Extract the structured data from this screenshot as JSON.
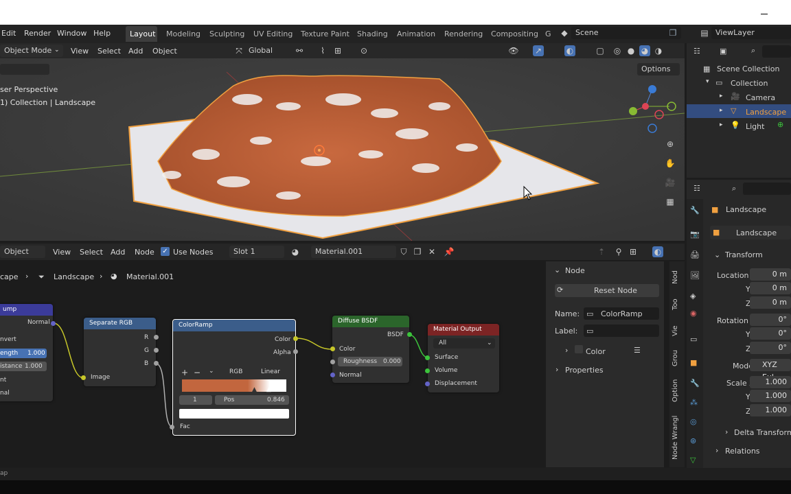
{
  "menu": [
    "Edit",
    "Render",
    "Window",
    "Help"
  ],
  "workspaces": [
    "Layout",
    "Modeling",
    "Sculpting",
    "UV Editing",
    "Texture Paint",
    "Shading",
    "Animation",
    "Rendering",
    "Compositing",
    "G"
  ],
  "scene": {
    "label": "Scene",
    "view_layer": "ViewLayer"
  },
  "viewport_header": {
    "mode": "Object Mode",
    "items": [
      "View",
      "Select",
      "Add",
      "Object"
    ],
    "orientation": "Global",
    "options": "Options"
  },
  "viewport": {
    "perspective": "ser Perspective",
    "collection": "1) Collection | Landscape"
  },
  "node_header": {
    "mode": "Object",
    "items": [
      "View",
      "Select",
      "Add",
      "Node"
    ],
    "use_nodes": "Use Nodes",
    "slot": "Slot 1",
    "material": "Material.001"
  },
  "breadcrumb": {
    "items": [
      "cape",
      "Landscape",
      "Material.001"
    ]
  },
  "nodes": {
    "left": {
      "title": "ump",
      "output": "Normal",
      "rows": [
        "nvert",
        "ength",
        "istance",
        "nt",
        "nal"
      ],
      "length_val": "1.000",
      "distance_val": "1.000"
    },
    "separate": {
      "title": "Separate RGB",
      "outputs": [
        "R",
        "G",
        "B"
      ],
      "input": "Image"
    },
    "colorramp": {
      "title": "ColorRamp",
      "outputs": [
        "Color",
        "Alpha"
      ],
      "plus": "+",
      "minus": "−",
      "mode": "RGB",
      "interp": "Linear",
      "index": "1",
      "pos_label": "Pos",
      "pos_val": "0.846",
      "input": "Fac"
    },
    "diffuse": {
      "title": "Diffuse BSDF",
      "output": "BSDF",
      "inputs": [
        "Color",
        "Normal"
      ],
      "roughness_label": "Roughness",
      "roughness_val": "0.000"
    },
    "matout": {
      "title": "Material Output",
      "target": "All",
      "inputs": [
        "Surface",
        "Volume",
        "Displacement"
      ]
    }
  },
  "npanel": {
    "section": "Node",
    "reset": "Reset Node",
    "name_label": "Name:",
    "name_val": "ColorRamp",
    "label_label": "Label:",
    "color": "Color",
    "properties": "Properties"
  },
  "side_tabs": [
    "Nod",
    "Too",
    "Vie",
    "Grou",
    "Option",
    "Node Wrangl"
  ],
  "outliner": {
    "root": "Scene Collection",
    "collection": "Collection",
    "items": [
      "Camera",
      "Landscape",
      "Light"
    ]
  },
  "properties": {
    "object": "Landscape",
    "data": "Landscape",
    "transform": "Transform",
    "location": {
      "label": "Location X",
      "y": "Y",
      "z": "Z",
      "vals": [
        "0 m",
        "0 m",
        "0 m"
      ]
    },
    "rotation": {
      "label": "Rotation X",
      "y": "Y",
      "z": "Z",
      "vals": [
        "0°",
        "0°",
        "0°"
      ]
    },
    "mode": {
      "label": "Mode",
      "val": "XYZ Eul"
    },
    "scale": {
      "label": "Scale X",
      "y": "Y",
      "z": "Z",
      "vals": [
        "1.000",
        "1.000",
        "1.000"
      ]
    },
    "delta": "Delta Transform",
    "relations": "Relations"
  },
  "status": {
    "text": "ap"
  },
  "colors": {
    "accent": "#4772b3",
    "selected_row": "#334d80",
    "node_color": "#246283",
    "node_shader": "#2b652b",
    "node_output": "#7c2424",
    "converter": "#3b5d8a",
    "landscape_orange": "#c2663e",
    "outline": "#f0a040"
  }
}
